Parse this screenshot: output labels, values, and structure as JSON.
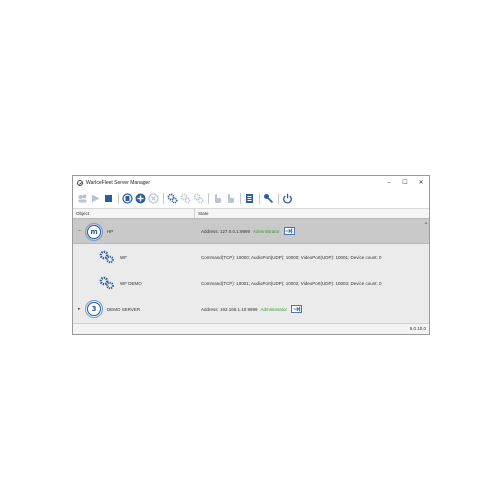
{
  "window": {
    "title": "WarIceFleet Server Manager",
    "controls": {
      "minimize": "–",
      "maximize": "☐",
      "close": "✕"
    }
  },
  "toolbar": {
    "buttons": [
      "users-icon",
      "play-icon",
      "stop-icon",
      "server-icon",
      "add-icon",
      "remove-icon",
      "gear-icon",
      "gear-plus-icon",
      "gear-minus-icon",
      "hand-pointer-icon",
      "hand-pointer-alt-icon",
      "log-icon",
      "key-icon",
      "power-icon"
    ]
  },
  "table": {
    "columns": {
      "object": "Object",
      "state": "State"
    }
  },
  "rows": [
    {
      "expander": "–",
      "object": "HP",
      "state": "Address: 127.0.0.1:9999",
      "role": "Administrator"
    },
    {
      "object": "WF",
      "state": "Command(TCP): 10000; AudioPort(UDP): 10000; VideoPort(UDP): 10001;  Device count: 0"
    },
    {
      "object": "WF DEMO",
      "state": "Command(TCP): 10001; AudioPort(UDP): 10002; VideoPort(UDP): 10003;  Device count: 0"
    },
    {
      "expander": "▸",
      "object": "DEMO SERVER",
      "state": "Address: 192.168.1.10:9999",
      "role": "Administrator"
    }
  ],
  "status": {
    "version": "5.0.10.0"
  },
  "colors": {
    "accent": "#2a5d9f",
    "role": "#2f9b2f",
    "selected_row": "#c9c9c9"
  }
}
